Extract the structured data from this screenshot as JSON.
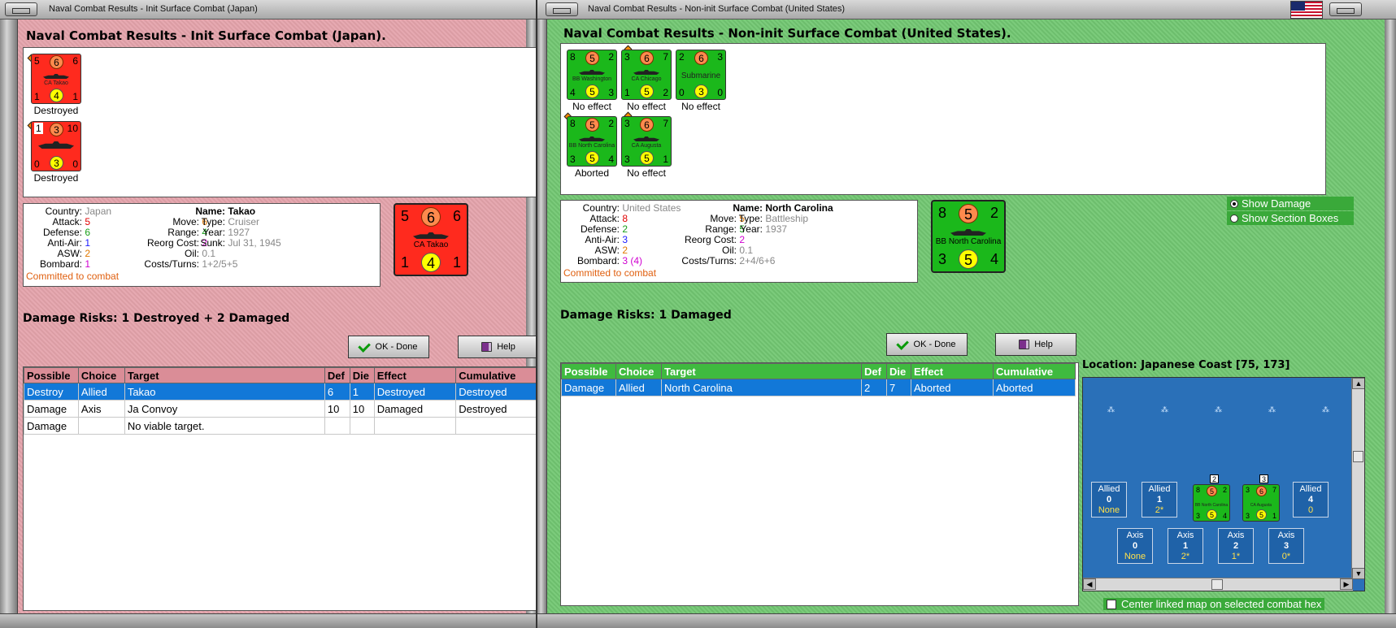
{
  "left": {
    "window_title": "Naval Combat Results - Init Surface Combat (Japan)",
    "heading": "Naval Combat Results - Init Surface Combat (Japan).",
    "units": [
      {
        "tl": "5",
        "tc": "6",
        "tr": "6",
        "bl": "1",
        "bc": "4",
        "br": "1",
        "name": "CA Takao",
        "result": "Destroyed"
      },
      {
        "tl": "1",
        "tc": "3",
        "tr": "10",
        "bl": "0",
        "bc": "3",
        "br": "0",
        "name": "",
        "result": "Destroyed"
      }
    ],
    "info": {
      "country_label": "Country:",
      "country": "Japan",
      "attack_label": "Attack:",
      "attack": "5",
      "defense_label": "Defense:",
      "defense": "6",
      "antiair_label": "Anti-Air:",
      "antiair": "1",
      "asw_label": "ASW:",
      "asw": "2",
      "bombard_label": "Bombard:",
      "bombard": "1",
      "move_label": "Move:",
      "move": "6",
      "range_label": "Range:",
      "range": "4",
      "reorg_label": "Reorg Cost:",
      "reorg": "2",
      "oil_label": "Oil:",
      "oil": "0.1",
      "costs_label": "Costs/Turns:",
      "costs": "1+2/5+5",
      "name_label": "Name:",
      "name": "Takao",
      "type_label": "Type:",
      "type": "Cruiser",
      "year_label": "Year:",
      "year": "1927",
      "sunk_label": "Sunk:",
      "sunk": "Jul 31, 1945",
      "status": "Committed to combat"
    },
    "big_counter": {
      "tl": "5",
      "tc": "6",
      "tr": "6",
      "bl": "1",
      "bc": "4",
      "br": "1",
      "name": "CA Takao"
    },
    "damage_risks": "Damage Risks:  1 Destroyed + 2 Damaged",
    "ok_label": "OK - Done",
    "help_label": "Help",
    "table": {
      "headers": [
        "Possible",
        "Choice",
        "Target",
        "Def",
        "Die",
        "Effect",
        "Cumulative"
      ],
      "rows": [
        [
          "Destroy",
          "Allied",
          "Takao",
          "6",
          "1",
          "Destroyed",
          "Destroyed"
        ],
        [
          "Damage",
          "Axis",
          "Ja Convoy",
          "10",
          "10",
          "Damaged",
          "Destroyed"
        ],
        [
          "Damage",
          "",
          "No viable target.",
          "",
          "",
          "",
          ""
        ]
      ]
    }
  },
  "right": {
    "window_title": "Naval Combat Results - Non-init Surface Combat (United States)",
    "heading": "Naval Combat Results - Non-init Surface Combat (United States).",
    "units": [
      {
        "tl": "8",
        "tc": "5",
        "tr": "2",
        "bl": "4",
        "bc": "5",
        "br": "3",
        "name": "BB Washington",
        "result": "No effect"
      },
      {
        "tl": "3",
        "tc": "6",
        "tr": "7",
        "bl": "1",
        "bc": "5",
        "br": "2",
        "name": "CA Chicago",
        "result": "No effect"
      },
      {
        "tl": "2",
        "tc": "6",
        "tr": "3",
        "bl": "0",
        "bc": "3",
        "br": "0",
        "name": "Submarine",
        "result": "No effect"
      },
      {
        "tl": "8",
        "tc": "5",
        "tr": "2",
        "bl": "3",
        "bc": "5",
        "br": "4",
        "name": "BB North Carolina",
        "result": "Aborted"
      },
      {
        "tl": "3",
        "tc": "6",
        "tr": "7",
        "bl": "3",
        "bc": "5",
        "br": "1",
        "name": "CA Augusta",
        "result": "No effect"
      }
    ],
    "info": {
      "country_label": "Country:",
      "country": "United States",
      "attack_label": "Attack:",
      "attack": "8",
      "defense_label": "Defense:",
      "defense": "2",
      "antiair_label": "Anti-Air:",
      "antiair": "3",
      "asw_label": "ASW:",
      "asw": "2",
      "bombard_label": "Bombard:",
      "bombard": "3 (4)",
      "move_label": "Move:",
      "move": "5",
      "range_label": "Range:",
      "range": "5",
      "reorg_label": "Reorg Cost:",
      "reorg": "2",
      "oil_label": "Oil:",
      "oil": "0.1",
      "costs_label": "Costs/Turns:",
      "costs": "2+4/6+6",
      "name_label": "Name:",
      "name": "North Carolina",
      "type_label": "Type:",
      "type": "Battleship",
      "year_label": "Year:",
      "year": "1937",
      "status": "Committed to combat"
    },
    "big_counter": {
      "tl": "8",
      "tc": "5",
      "tr": "2",
      "bl": "3",
      "bc": "5",
      "br": "4",
      "name": "BB North Carolina"
    },
    "options": {
      "show_damage": "Show Damage",
      "show_sections": "Show Section Boxes"
    },
    "damage_risks": "Damage Risks:  1 Damaged",
    "ok_label": "OK - Done",
    "help_label": "Help",
    "table": {
      "headers": [
        "Possible",
        "Choice",
        "Target",
        "Def",
        "Die",
        "Effect",
        "Cumulative"
      ],
      "rows": [
        [
          "Damage",
          "Allied",
          "North Carolina",
          "2",
          "7",
          "Aborted",
          "Aborted"
        ]
      ]
    },
    "location": "Location:  Japanese Coast [75, 173]",
    "map": {
      "allied_boxes": [
        {
          "side": "Allied",
          "num": "0",
          "val": "None"
        },
        {
          "side": "Allied",
          "num": "1",
          "val": "2*"
        },
        {
          "side": "Allied",
          "num": "4",
          "val": "0"
        }
      ],
      "axis_boxes": [
        {
          "side": "Axis",
          "num": "0",
          "val": "None"
        },
        {
          "side": "Axis",
          "num": "1",
          "val": "2*"
        },
        {
          "side": "Axis",
          "num": "2",
          "val": "1*"
        },
        {
          "side": "Axis",
          "num": "3",
          "val": "0*"
        }
      ],
      "stack_counts": [
        "2",
        "3"
      ],
      "stack_units": [
        {
          "tl": "8",
          "tc": "5",
          "tr": "2",
          "bl": "3",
          "bc": "5",
          "br": "4",
          "name": "BB North Carolina"
        },
        {
          "tl": "3",
          "tc": "6",
          "tr": "7",
          "bl": "3",
          "bc": "5",
          "br": "1",
          "name": "CA Augusta"
        }
      ]
    },
    "center_checkbox_label": "Center linked map on selected combat hex"
  }
}
